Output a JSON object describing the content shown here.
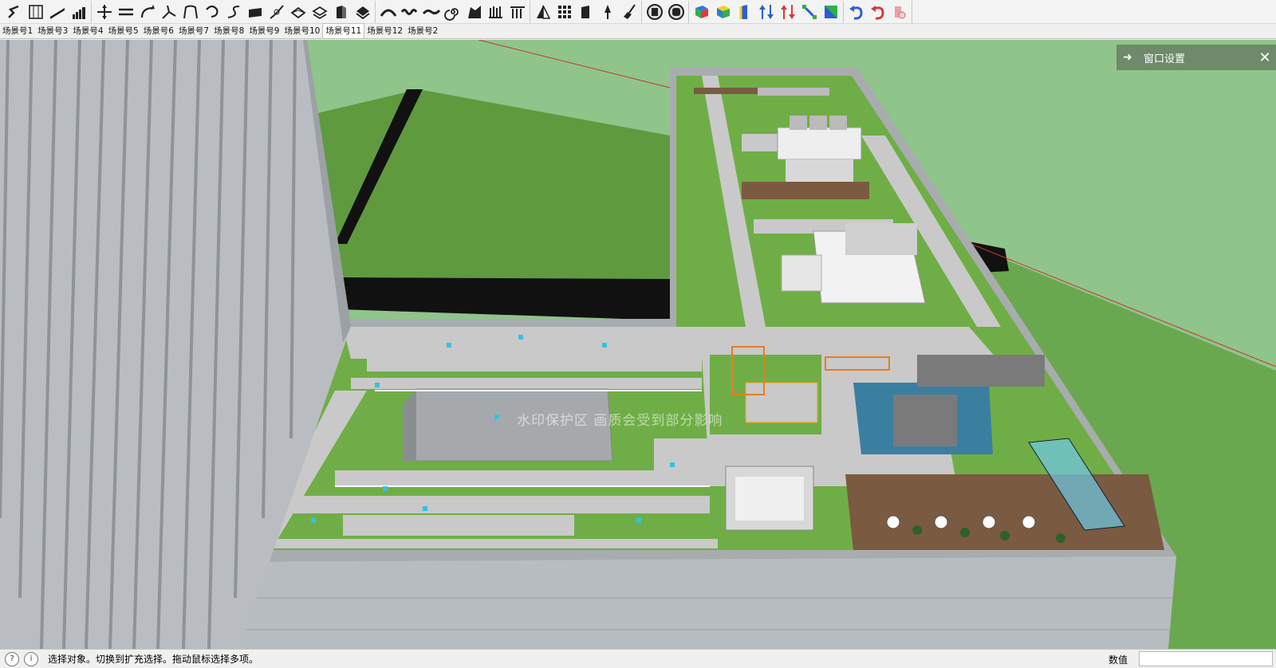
{
  "toolbar": {
    "groups": [
      [
        "follow-me-icon",
        "wall-icon",
        "ramp-icon",
        "stairs-icon"
      ],
      [
        "move-icon",
        "align-icon",
        "rotate-icon",
        "flip-icon",
        "arc-icon",
        "loop-icon",
        "offset-icon",
        "rectangle-icon",
        "curve-icon",
        "extrude-icon",
        "layers-icon",
        "solid-icon",
        "material-icon"
      ],
      [
        "arch-icon",
        "wave-icon",
        "spline-icon",
        "spiral-icon",
        "fold-icon",
        "column-icon",
        "colonnade-icon"
      ],
      [
        "mirror-icon",
        "array-icon",
        "box-icon",
        "pin-icon",
        "broom-icon"
      ],
      [
        "window-frame-icon",
        "rounded-frame-icon"
      ],
      [
        "cube-green-icon",
        "cube-yellow-icon",
        "axis-icon",
        "arrows-up-icon",
        "arrows-down-icon",
        "scale-icon",
        "flip-box-icon"
      ],
      [
        "undo-icon",
        "redo-icon",
        "eraser-icon"
      ]
    ]
  },
  "scene_tabs": [
    {
      "label": "场景号1",
      "active": false
    },
    {
      "label": "场景号3",
      "active": false
    },
    {
      "label": "场景号4",
      "active": false
    },
    {
      "label": "场景号5",
      "active": false
    },
    {
      "label": "场景号6",
      "active": false
    },
    {
      "label": "场景号7",
      "active": false
    },
    {
      "label": "场景号8",
      "active": false
    },
    {
      "label": "场景号9",
      "active": false
    },
    {
      "label": "场景号10",
      "active": false
    },
    {
      "label": "场景号11",
      "active": true
    },
    {
      "label": "场景号12",
      "active": false
    },
    {
      "label": "场景号2",
      "active": false
    }
  ],
  "window_panel": {
    "title": "窗口设置",
    "arrow_icon": "arrow-right-icon",
    "close_icon": "close-icon"
  },
  "watermark": "水印保护区  画质会受到部分影响",
  "status": {
    "message": "选择对象。切换到扩充选择。拖动鼠标选择多项。",
    "measure_label": "数值",
    "measure_value": ""
  },
  "colors": {
    "sky": "#8fc48a",
    "lawn": "#5f9a3f",
    "grass": "#6fae46",
    "path": "#c9c9c9",
    "deck": "#7a5a40",
    "water": "#3b7fa0",
    "facade": "#b7bcc0"
  }
}
